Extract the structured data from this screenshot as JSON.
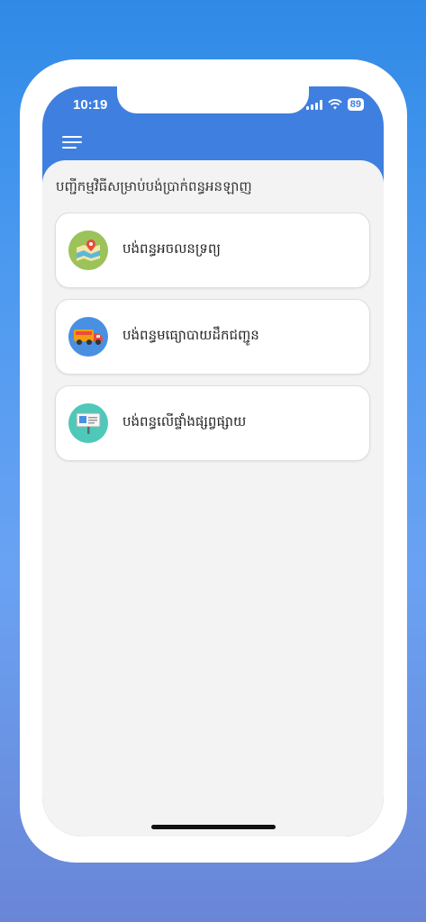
{
  "status_bar": {
    "time": "10:19",
    "battery": "89"
  },
  "page": {
    "title": "បញ្ជីកម្មវិធីសម្រាប់បង់ប្រាក់ពន្ធអនឡាញ"
  },
  "services": [
    {
      "label": "បង់ពន្ធអចលនទ្រព្យ",
      "icon": "map-icon",
      "color": "#9cc25a"
    },
    {
      "label": "បង់ពន្ធមធ្យោបាយដឹកជញ្ជូន",
      "icon": "truck-icon",
      "color": "#4a90e2"
    },
    {
      "label": "បង់ពន្ធលើផ្ទាំងផ្សព្វផ្សាយ",
      "icon": "billboard-icon",
      "color": "#4ec9b9"
    }
  ]
}
